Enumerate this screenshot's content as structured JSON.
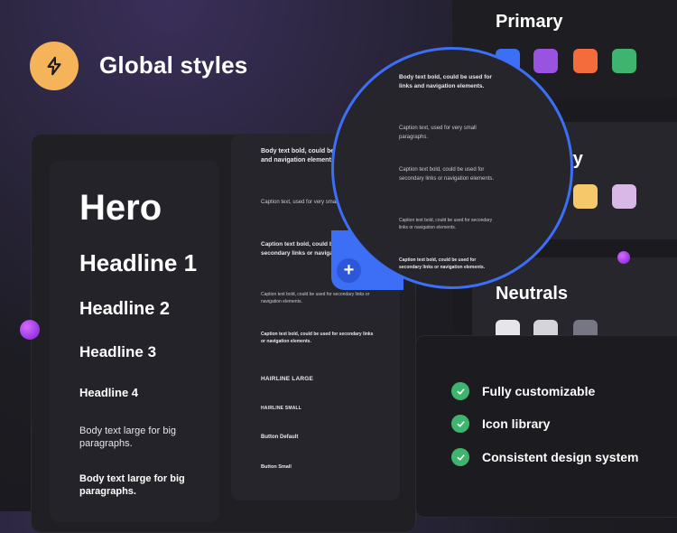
{
  "header": {
    "title": "Global styles",
    "logo_icon": "lightning-bolt-icon",
    "logo_color": "#f5b45a"
  },
  "typography": {
    "hero": "Hero",
    "headline1": "Headline 1",
    "headline2": "Headline 2",
    "headline3": "Headline 3",
    "headline4": "Headline 4",
    "body_large": "Body text large for big paragraphs.",
    "body_large_bold": "Body text large for big paragraphs.",
    "small": {
      "body_bold": "Body text bold, could be used for links and navigation elements.",
      "caption": "Caption text, used for very small paragraphs.",
      "caption_bold": "Caption text bold, could be used for secondary links or navigation elements.",
      "caption_bold_regular": "Caption text bold, could be used for secondary links or navigation elements.",
      "caption_bold_small": "Caption text bold, could be used for secondary links or navigation elements.",
      "hairline_large": "HAIRLINE LARGE",
      "hairline_small": "HAIRLINE SMALL",
      "button_default": "Button Default",
      "button_small": "Button Small"
    }
  },
  "magnifier": {
    "body_bold": "Body text bold, could be used for links and navigation elements.",
    "caption": "Caption text, used for very small paragraphs.",
    "caption_bold": "Caption text bold, could be used for secondary links or navigation elements.",
    "caption_bold_regular": "Caption text bold, could be used for secondary links or navigation elements.",
    "caption_bold_small": "Caption text bold, could be used for secondary links or navigation elements.",
    "plus_label": "+",
    "accent": "#3c6ff5"
  },
  "palettes": {
    "primary": {
      "title": "Primary",
      "colors": [
        "#3c6ff5",
        "#9a52e0",
        "#f46b3c",
        "#3fb46e"
      ]
    },
    "secondary": {
      "title_visible": "ry",
      "colors": [
        "#3c6ff5",
        "#f5c86a",
        "#d9b8e8"
      ]
    },
    "neutrals": {
      "title": "Neutrals",
      "colors": [
        "#e6e6ea",
        "#d4d4da",
        "#767684"
      ]
    }
  },
  "features": [
    {
      "label": "Fully customizable"
    },
    {
      "label": "Icon library"
    },
    {
      "label": "Consistent design system"
    }
  ]
}
